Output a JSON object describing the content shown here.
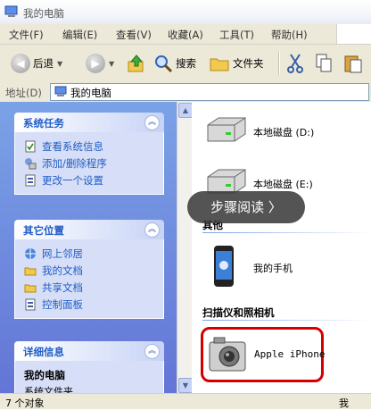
{
  "window": {
    "title": "我的电脑"
  },
  "menu": [
    "文件(F)",
    "编辑(E)",
    "查看(V)",
    "收藏(A)",
    "工具(T)",
    "帮助(H)"
  ],
  "toolbar": {
    "back_label": "后退",
    "search_label": "搜索",
    "folders_label": "文件夹"
  },
  "address": {
    "label": "地址(D)",
    "value": "我的电脑"
  },
  "tasks": {
    "system": {
      "title": "系统任务",
      "items": [
        "查看系统信息",
        "添加/删除程序",
        "更改一个设置"
      ]
    },
    "places": {
      "title": "其它位置",
      "items": [
        "网上邻居",
        "我的文档",
        "共享文档",
        "控制面板"
      ]
    },
    "details": {
      "title": "详细信息",
      "name": "我的电脑",
      "desc": "系统文件夹"
    }
  },
  "content": {
    "drive_d": "本地磁盘 (D:)",
    "drive_e": "本地磁盘 (E:)",
    "other_header": "其他",
    "phone_label": "我的手机",
    "scanner_header": "扫描仪和照相机",
    "camera_label": "Apple iPhone"
  },
  "overlay": {
    "label": "步骤阅读 〉"
  },
  "status": {
    "count": "7 个对象",
    "right": "我"
  },
  "colors": {
    "highlight": "#d40000",
    "panel_text": "#215dc6"
  }
}
